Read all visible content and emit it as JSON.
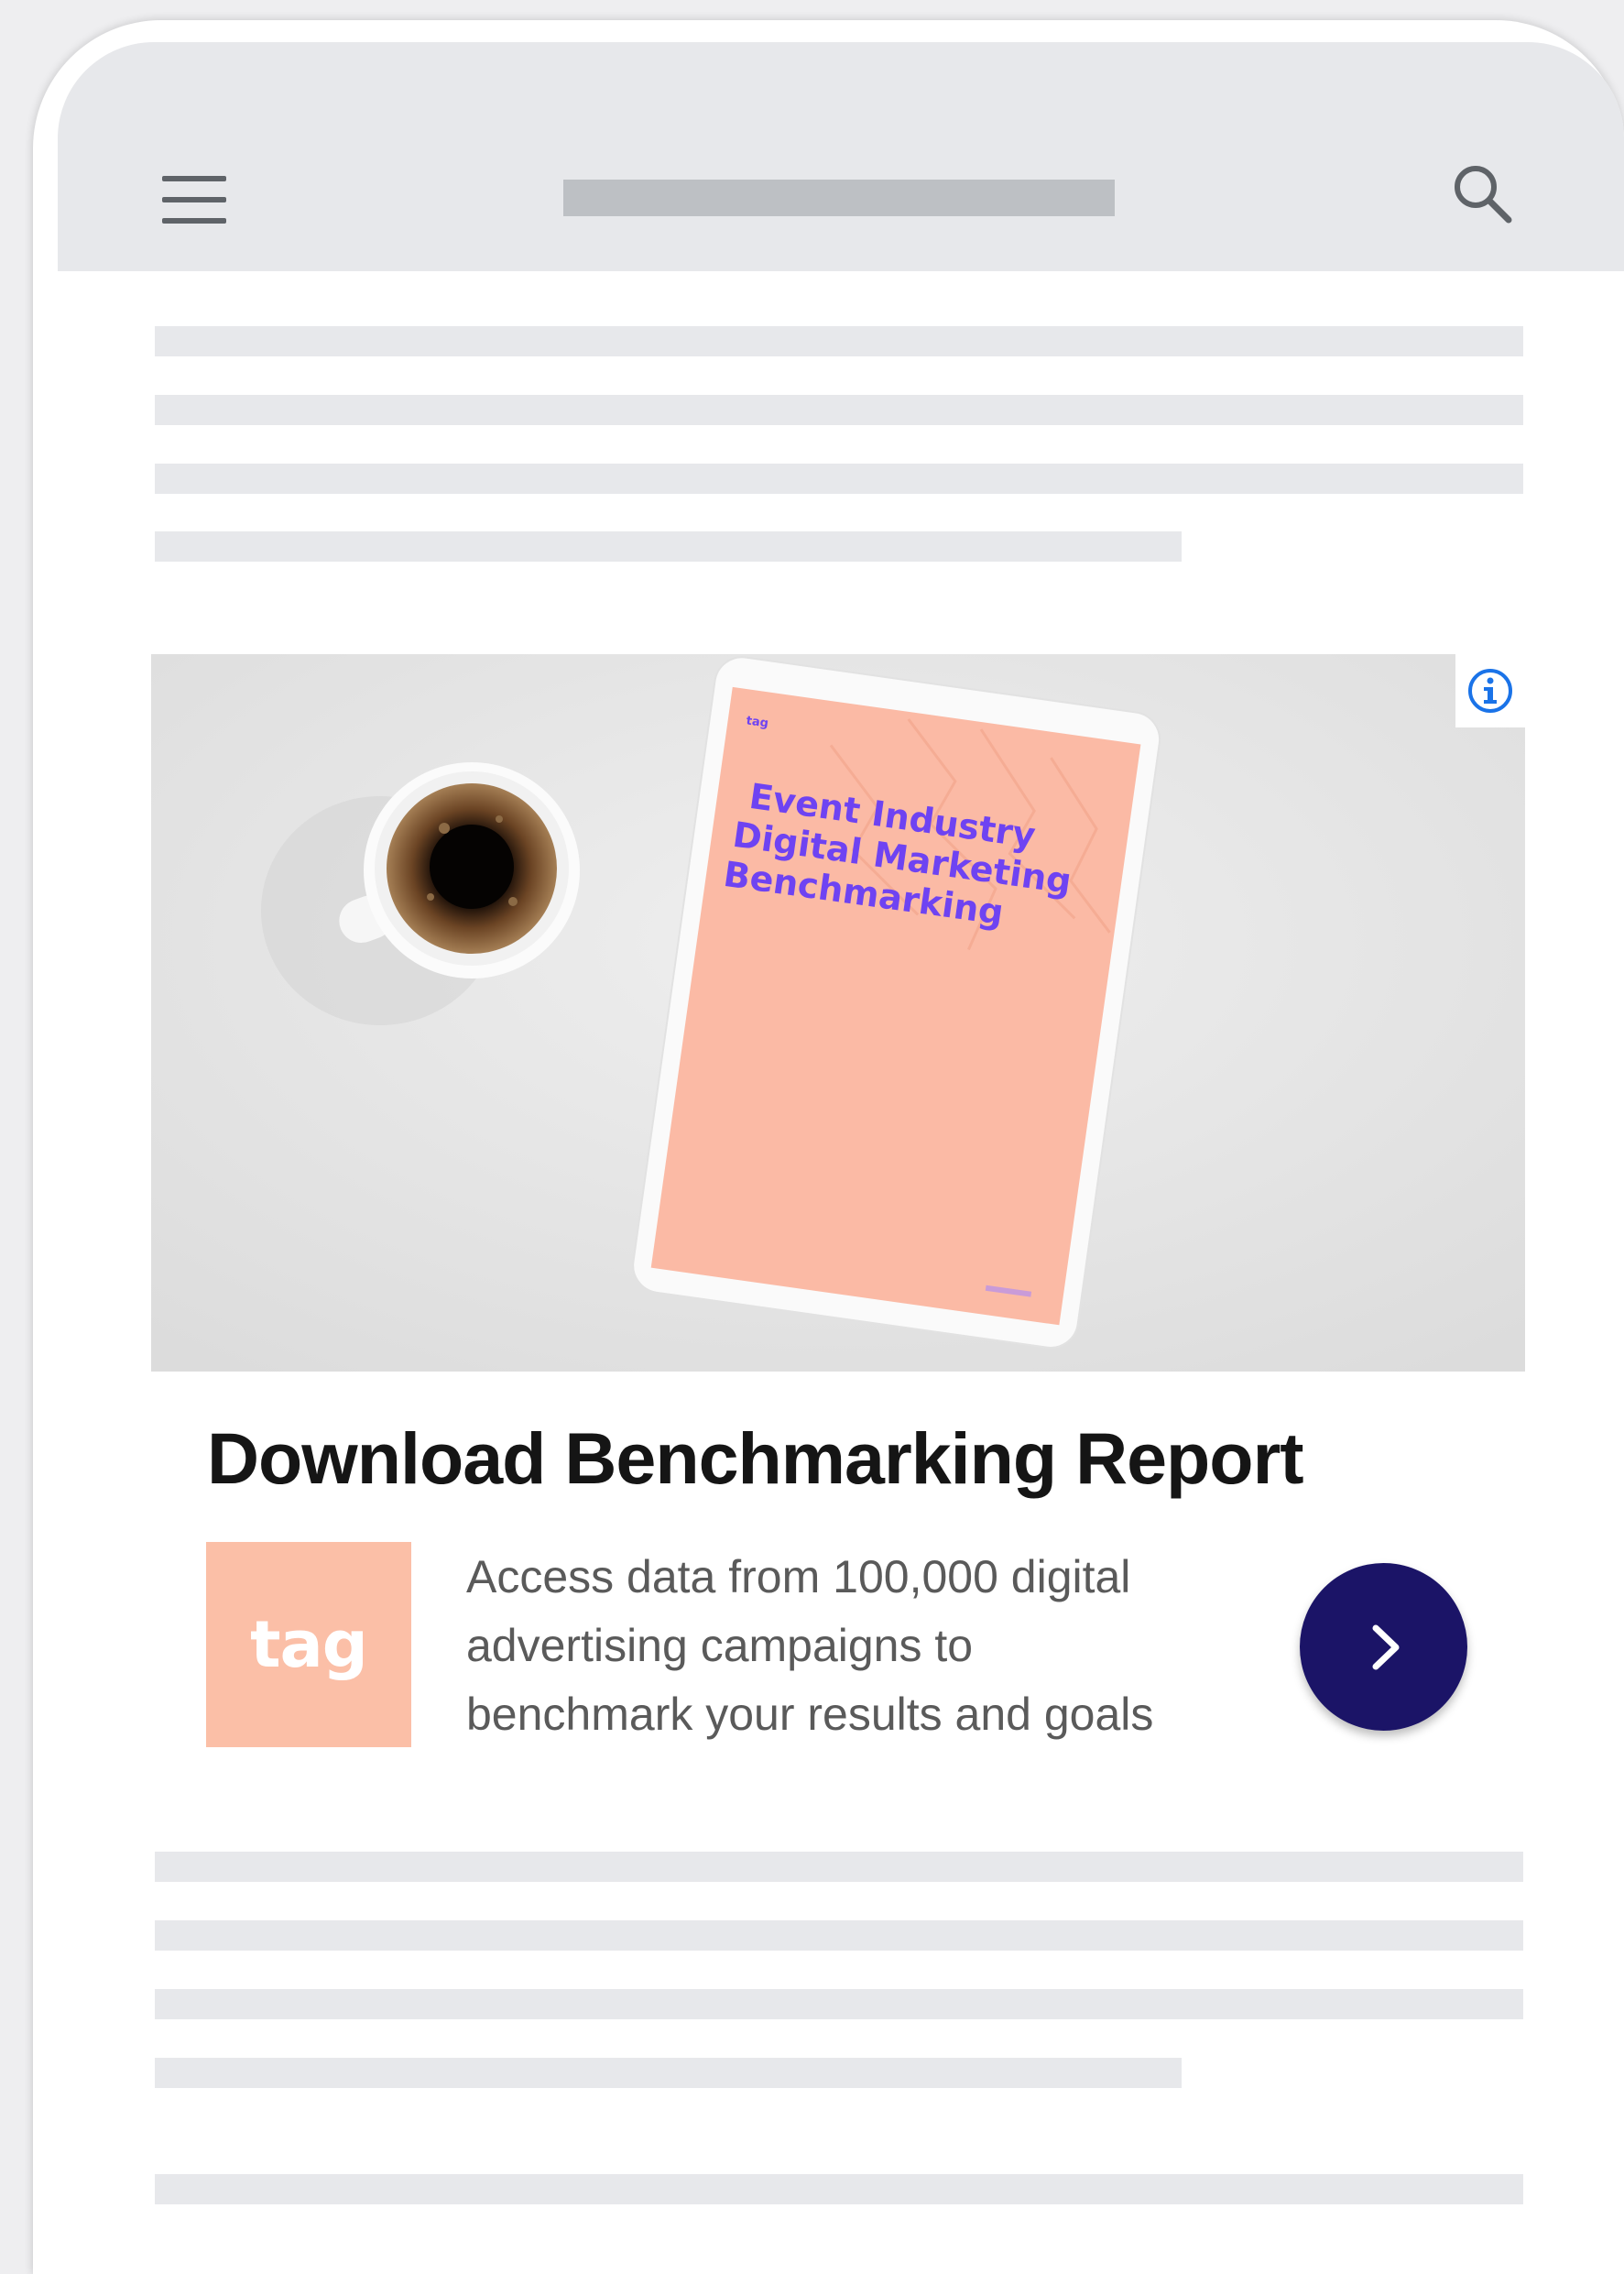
{
  "ad": {
    "tablet_cover": {
      "brand": "tag",
      "title_lines": [
        "Event Industry",
        "Digital Marketing",
        "Benchmarking"
      ]
    },
    "headline": "Download Benchmarking Report",
    "advertiser_logo_text": "tag",
    "body_lines": [
      "Access data from 100,000 digital",
      "advertising campaigns to",
      "benchmark your results and goals"
    ]
  },
  "icons": {
    "menu": "hamburger-menu-icon",
    "search": "search-icon",
    "info": "info-icon",
    "cta": "chevron-right-icon"
  },
  "colors": {
    "placeholder_gray": "#e7e8eb",
    "logo_peach": "#fbbfa7",
    "cta_navy": "#1b1467",
    "info_blue": "#1a73e8",
    "cover_text_purple": "#6e43f2"
  }
}
